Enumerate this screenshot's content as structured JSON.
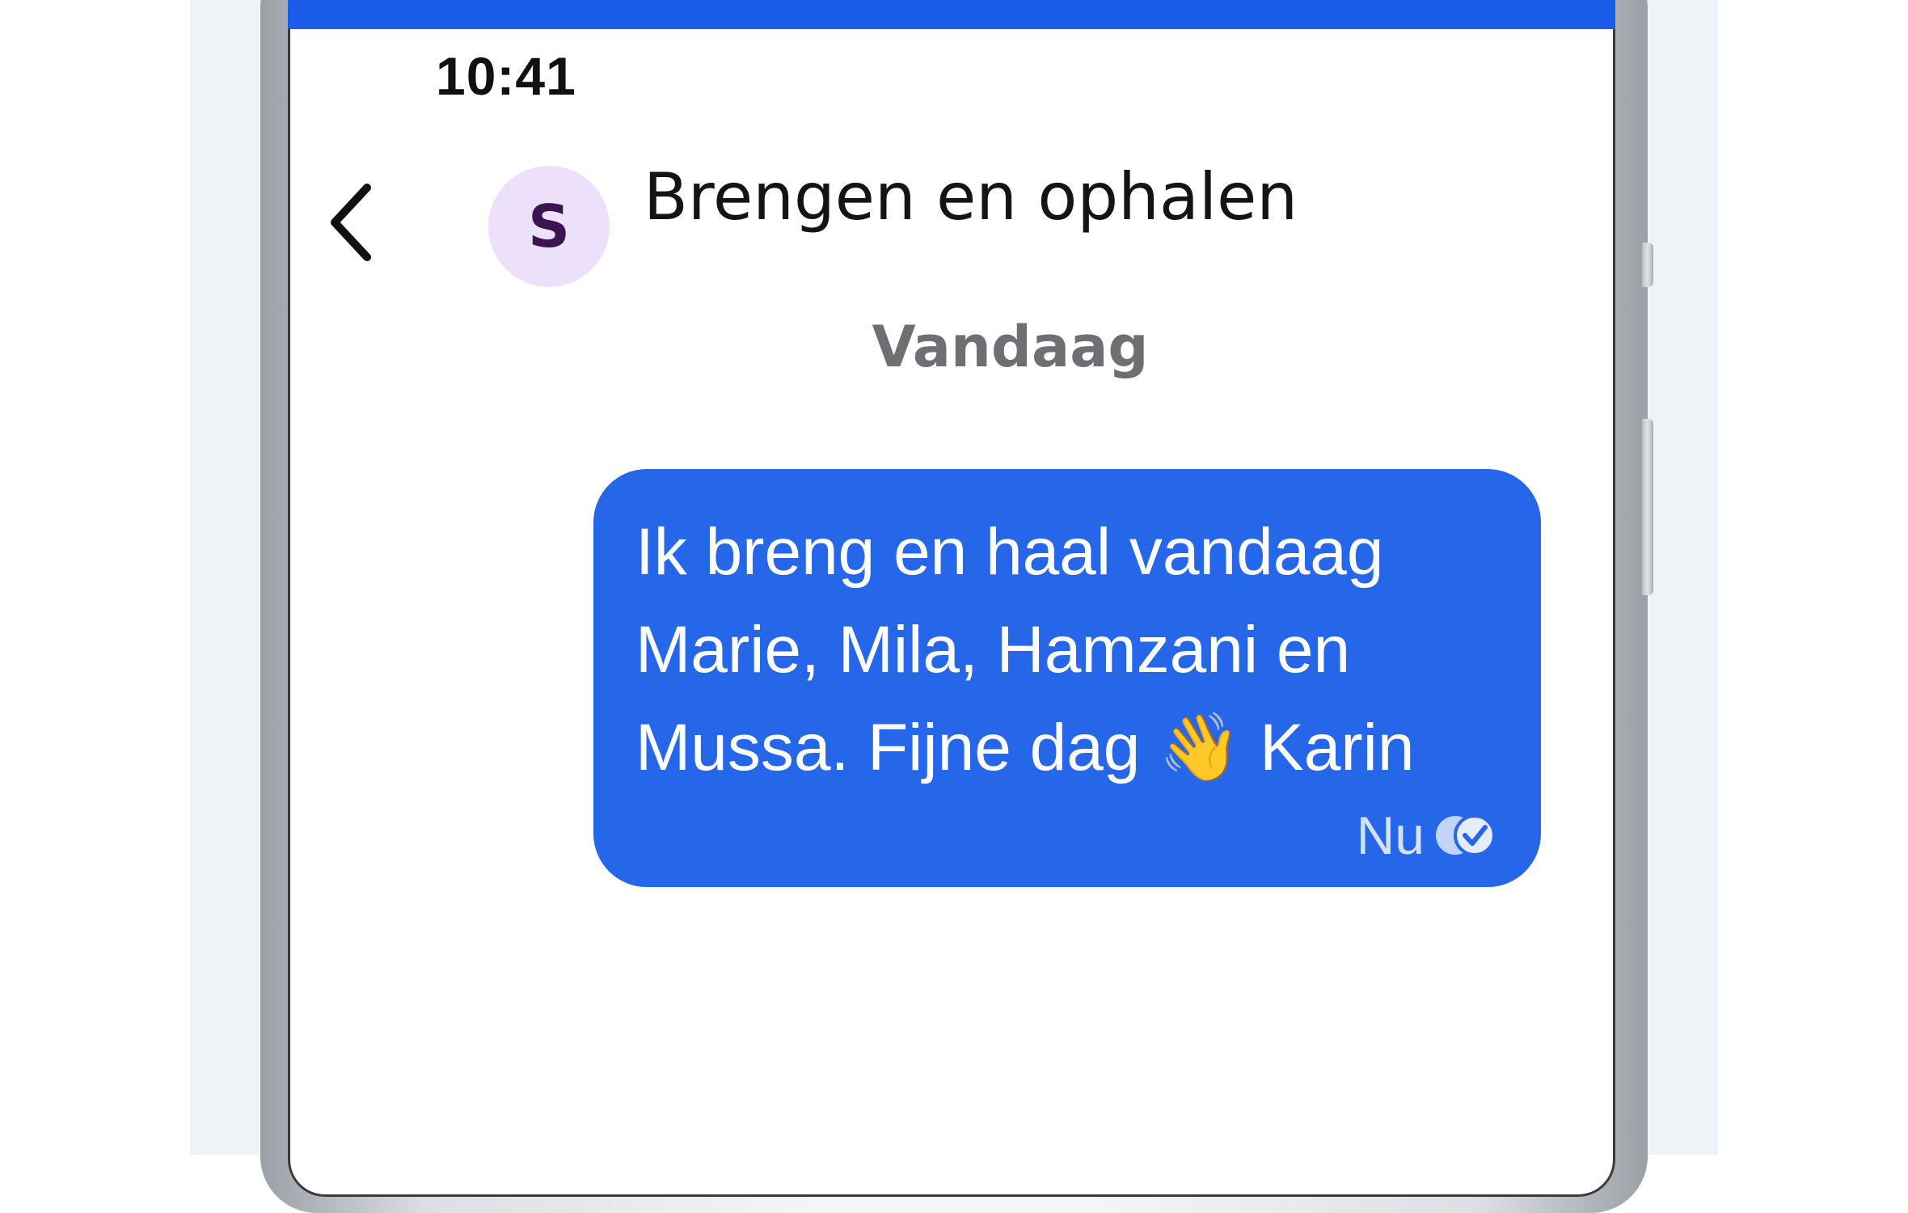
{
  "status_bar": {
    "time": "10:41"
  },
  "header": {
    "back_icon": "chevron-left-icon",
    "avatar_initial": "S",
    "avatar_bg_color": "#ece0fb",
    "avatar_text_color": "#3b1451",
    "title": "Brengen en ophalen"
  },
  "conversation": {
    "date_separator": "Vandaag",
    "messages": [
      {
        "text": "Ik breng en haal vandaag\nMarie, Mila, Hamzani en\nMussa. Fijne dag 👋 Karin",
        "time": "Nu",
        "status_icon": "read-receipt-icon",
        "bubble_color": "#2667e9"
      }
    ]
  },
  "theme": {
    "accent": "#1b5cea",
    "text": "#141414",
    "muted": "#6f6f73"
  }
}
